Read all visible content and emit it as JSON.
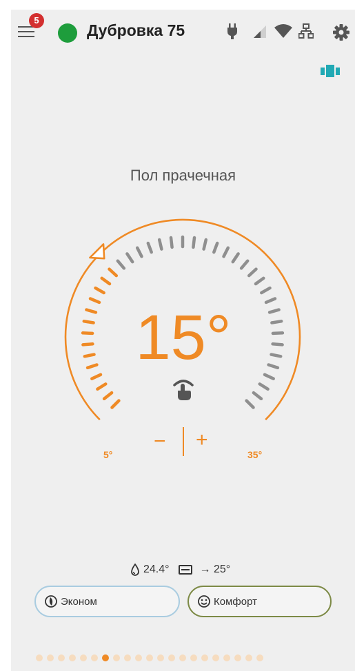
{
  "header": {
    "title": "Дубровка 75",
    "notification_count": "5",
    "status_color": "#1e9d3c",
    "icons": [
      "menu-icon",
      "plug-icon",
      "cellular-signal-icon",
      "wifi-icon",
      "ethernet-network-icon",
      "gear-icon"
    ]
  },
  "zone": {
    "name": "Пол прачечная",
    "target_temperature": "15°",
    "min_label": "5°",
    "max_label": "35°",
    "setpoint_value": 15,
    "range": [
      5,
      35
    ],
    "minus_label": "−",
    "plus_label": "+"
  },
  "readings": {
    "floor_temp": "24.4°",
    "target": "→ 25°"
  },
  "modes": {
    "economy_label": "Эконом",
    "comfort_label": "Комфорт"
  },
  "pager": {
    "total": 21,
    "active_index": 6
  },
  "colors": {
    "accent": "#ef8a25",
    "economy_border": "#a9cce0",
    "comfort_border": "#7d8a46",
    "dual_icon": "#21a9b4"
  }
}
